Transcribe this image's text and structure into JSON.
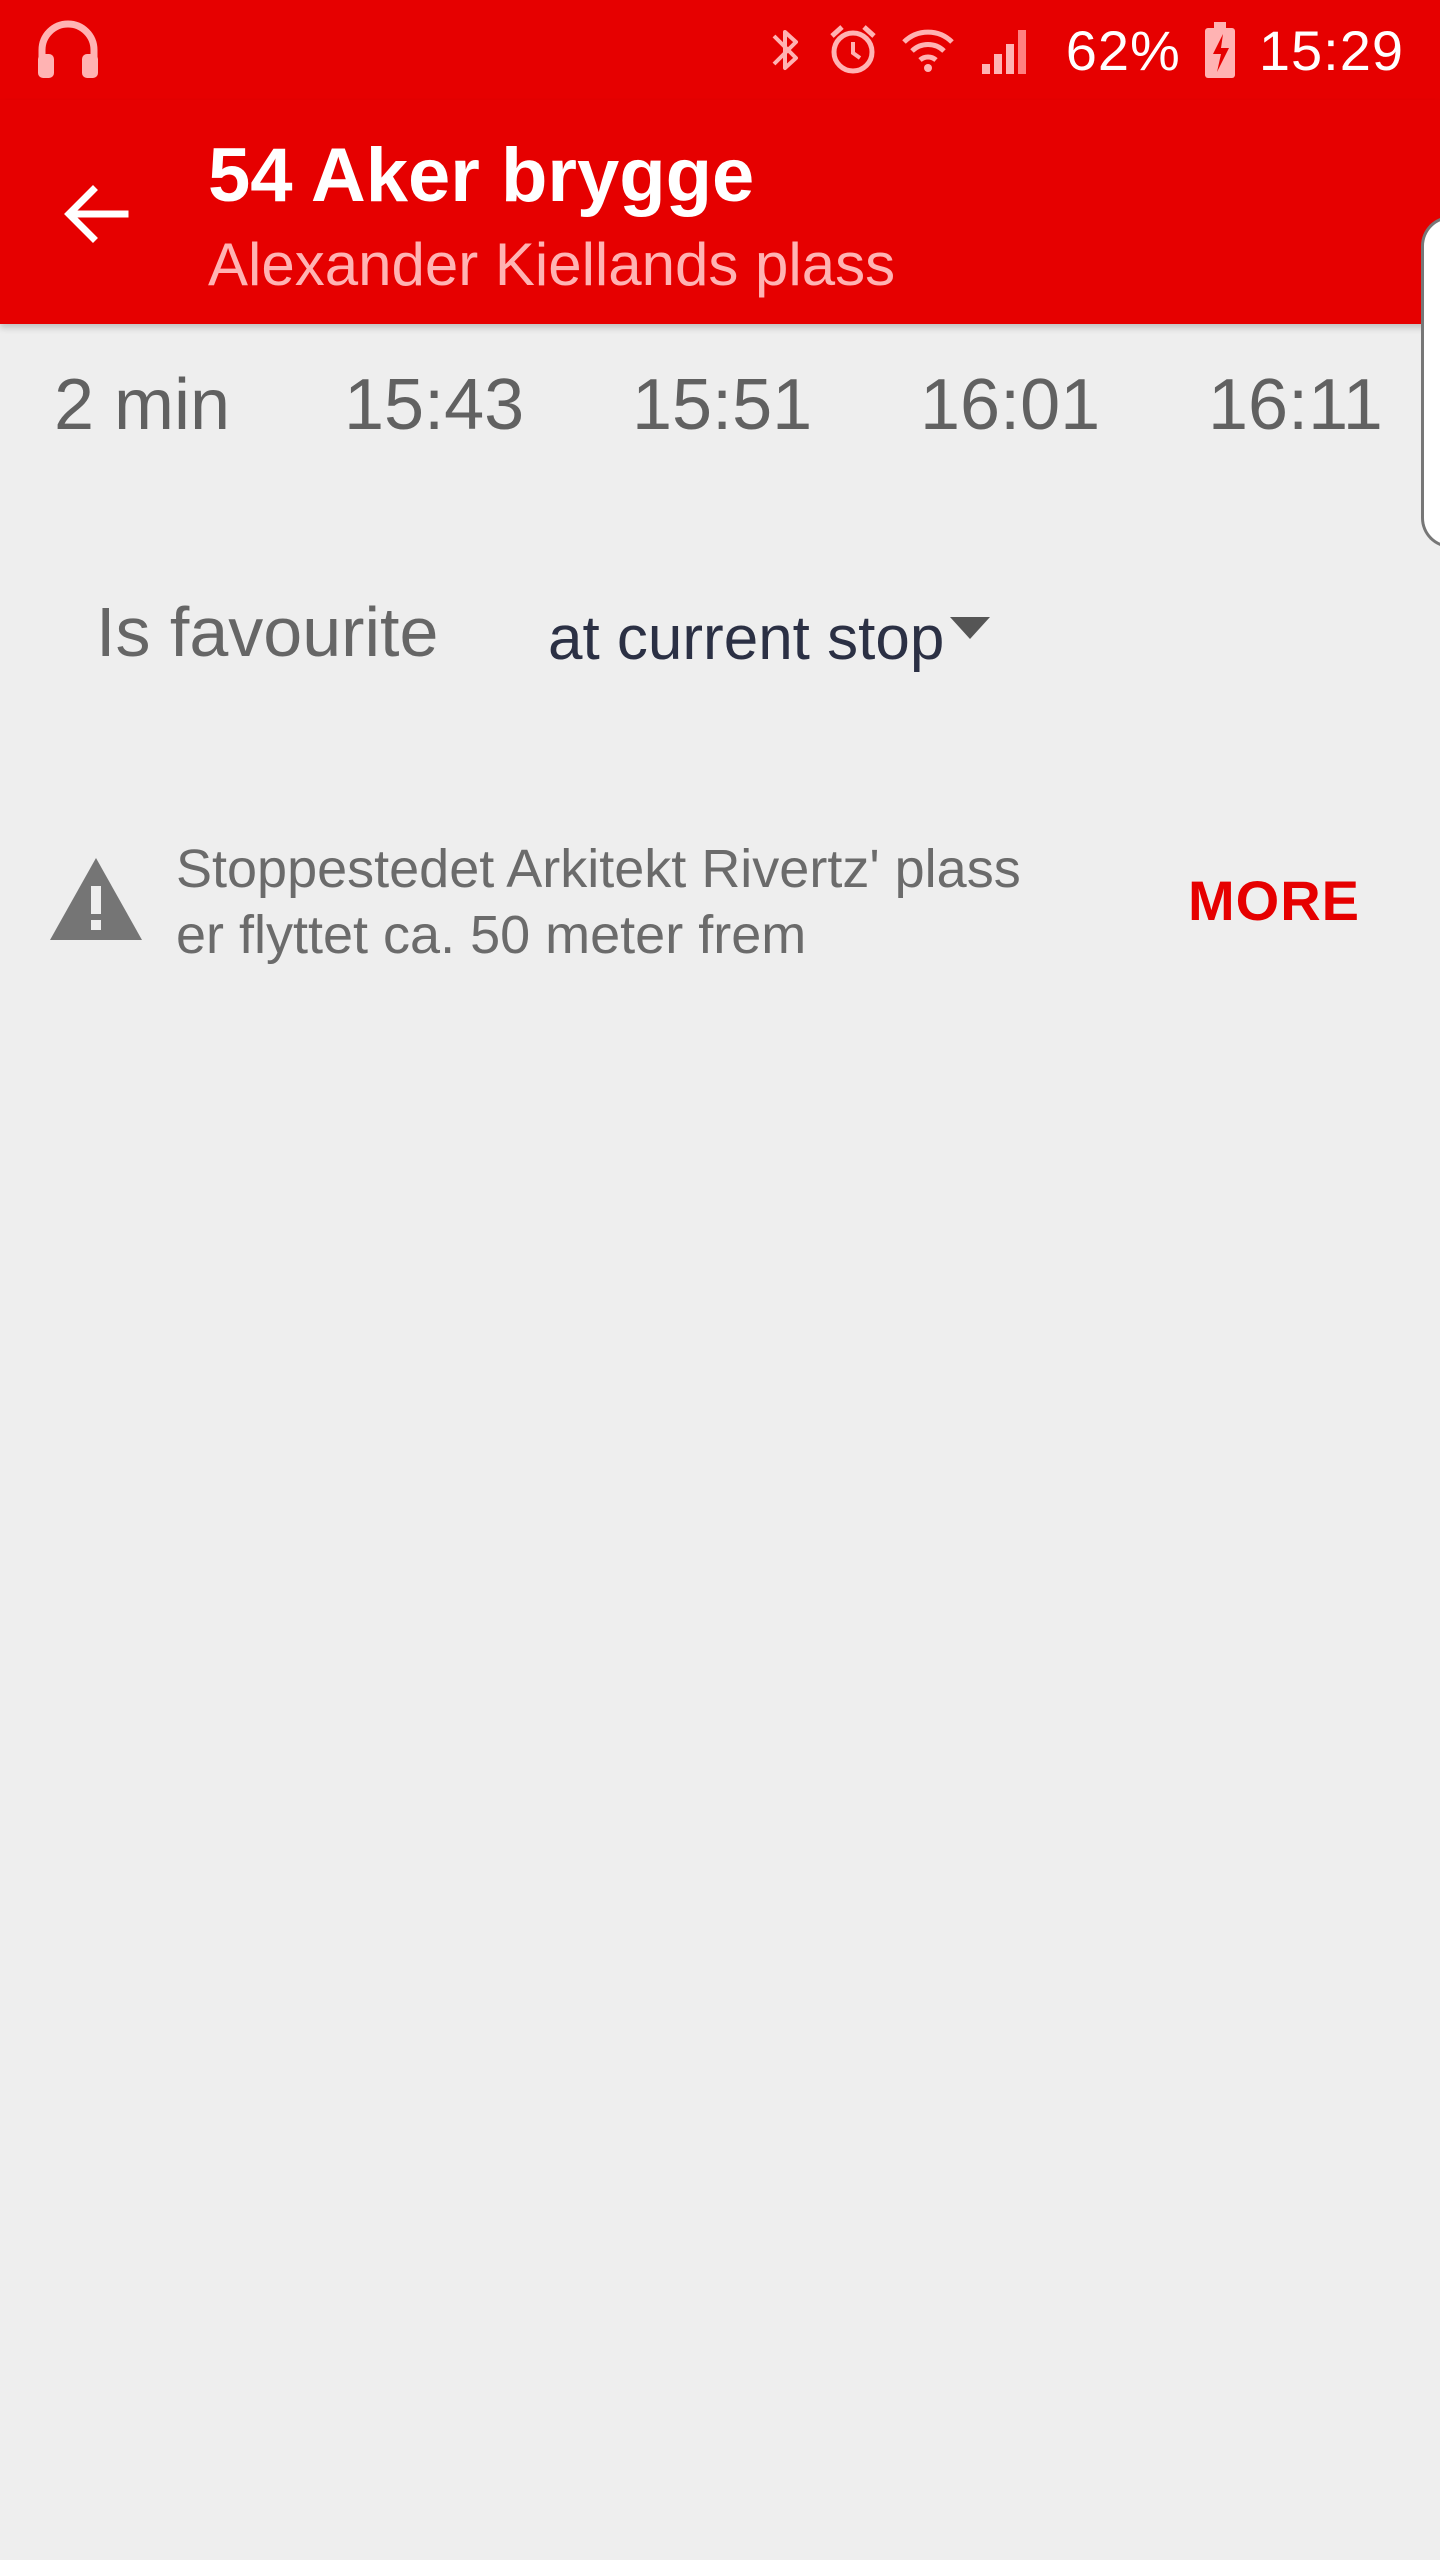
{
  "status_bar": {
    "left_icon": "headphones-icon",
    "icons": [
      "bluetooth-icon",
      "alarm-icon",
      "wifi-icon",
      "signal-icon"
    ],
    "battery_percent": "62%",
    "battery_icon": "battery-charging-icon",
    "time": "15:29"
  },
  "app_bar": {
    "back_icon": "arrow-back-icon",
    "title": "54 Aker brygge",
    "subtitle": "Alexander Kiellands plass",
    "color": "#e60000",
    "subtitle_color": "#ffb3b3"
  },
  "departures": [
    "2 min",
    "15:43",
    "15:51",
    "16:01",
    "16:11"
  ],
  "favourite": {
    "label": "Is favourite",
    "selected": "at current stop"
  },
  "notice": {
    "icon": "warning-icon",
    "line1": "Stoppestedet Arkitekt Rivertz' plass",
    "line2": "er flyttet ca. 50 meter frem",
    "action": "MORE"
  },
  "colors": {
    "accent": "#e60000",
    "background": "#eeeeee"
  }
}
